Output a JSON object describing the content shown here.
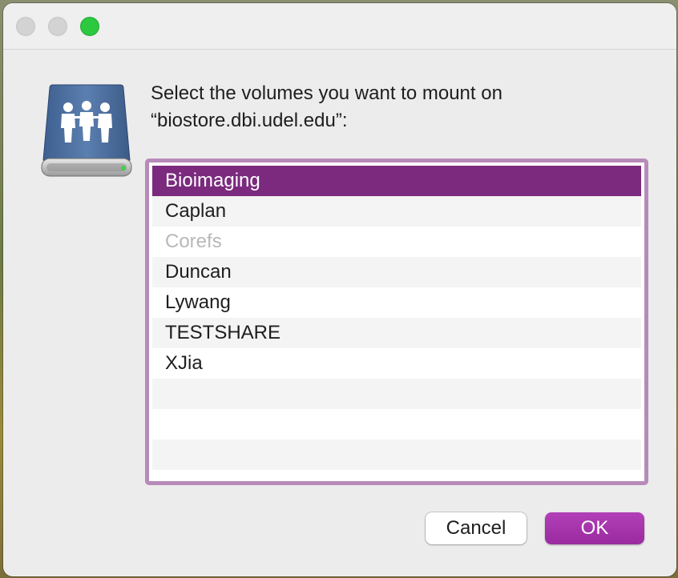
{
  "dialog": {
    "prompt_line1": "Select the volumes you want to mount on",
    "prompt_line2": "“biostore.dbi.udel.edu”:"
  },
  "icon": {
    "semantic": "shared-server-volume-icon"
  },
  "volumes": [
    {
      "label": "Bioimaging",
      "state": "selected"
    },
    {
      "label": "Caplan",
      "state": "normal"
    },
    {
      "label": "Corefs",
      "state": "disabled"
    },
    {
      "label": "Duncan",
      "state": "normal"
    },
    {
      "label": "Lywang",
      "state": "normal"
    },
    {
      "label": "TESTSHARE",
      "state": "normal"
    },
    {
      "label": "XJia",
      "state": "normal"
    }
  ],
  "buttons": {
    "cancel_label": "Cancel",
    "ok_label": "OK"
  },
  "colors": {
    "accent": "#7b2a7e",
    "ok_button": "#a835ad",
    "list_border": "#b78bb9",
    "traffic_zoom": "#2bc840"
  }
}
